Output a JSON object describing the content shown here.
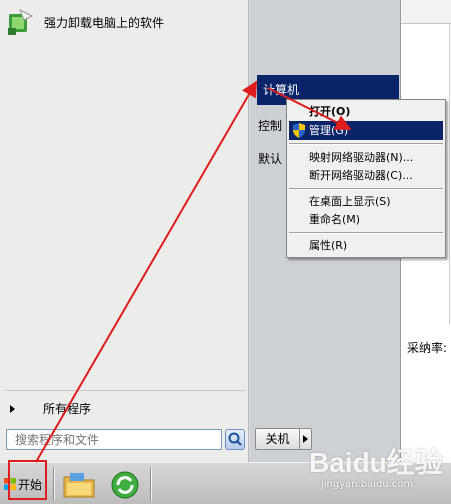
{
  "start_menu": {
    "pinned": [
      {
        "label": "强力卸载电脑上的软件",
        "icon": "uninstaller-icon"
      }
    ],
    "all_programs_label": "所有程序",
    "search_placeholder": "搜索程序和文件",
    "right_items": [
      {
        "label": "计算机",
        "selected": true
      },
      {
        "label": "控制",
        "selected": false
      },
      {
        "label": "默认",
        "selected": false
      }
    ],
    "shutdown_label": "关机"
  },
  "context_menu": {
    "items": [
      {
        "label": "打开(O)",
        "bold": true
      },
      {
        "label": "管理(G)",
        "highlight": true,
        "icon": "uac-shield-icon"
      },
      {
        "label": "映射网络驱动器(N)..."
      },
      {
        "label": "断开网络驱动器(C)..."
      },
      {
        "label": "在桌面上显示(S)"
      },
      {
        "label": "重命名(M)"
      },
      {
        "label": "属性(R)"
      }
    ]
  },
  "taskbar": {
    "start_label": "开始",
    "pinned_icons": [
      "explorer-folder-icon",
      "refresh-app-icon"
    ]
  },
  "background_window": {
    "label": "采纳率:"
  },
  "watermark": {
    "brand": "Baidu经验",
    "url": "jingyan.baidu.com"
  },
  "colors": {
    "highlight": "#0a246a",
    "annotation_red": "#e01c1c",
    "menu_bg": "#f0f0f0"
  }
}
